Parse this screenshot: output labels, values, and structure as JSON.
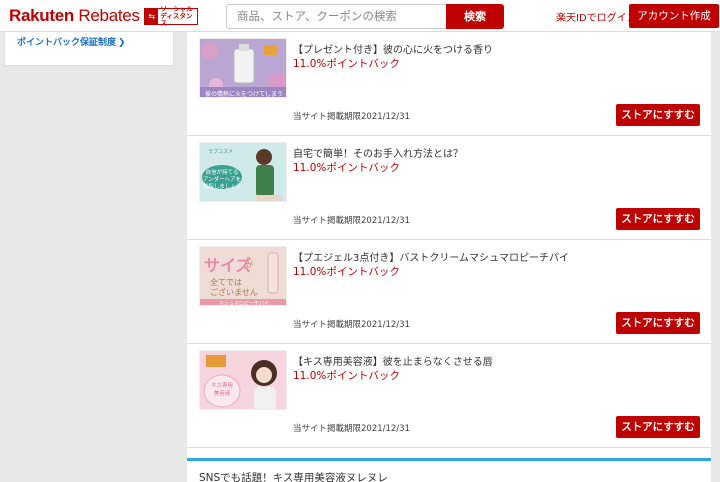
{
  "header": {
    "logo_primary": "Rakuten",
    "logo_secondary": "Rebates",
    "social_badge_line1": "ソーシャル",
    "social_badge_line2": "ディスタンス",
    "search_placeholder": "商品、ストア、クーポンの検索",
    "search_button": "検索",
    "login_link": "楽天IDでログイン",
    "signup_button": "アカウント作成"
  },
  "sidebar": {
    "guarantee_link": "ポイントバック保証制度"
  },
  "cards": [
    {
      "title": "【プレゼント付き】彼の心に火をつける香り",
      "points": "11.0%ポイントバック",
      "deadline": "当サイト掲載期限2021/12/31",
      "button": "ストアにすすむ"
    },
    {
      "title": "自宅で簡単！そのお手入れ方法とは？",
      "points": "11.0%ポイントバック",
      "deadline": "当サイト掲載期限2021/12/31",
      "button": "ストアにすすむ"
    },
    {
      "title": "【プエジェル3点付き】バストクリームマシュマロピーチパイ",
      "points": "11.0%ポイントバック",
      "deadline": "当サイト掲載期限2021/12/31",
      "button": "ストアにすすむ"
    },
    {
      "title": "【キス専用美容液】彼を止まらなくさせる唇",
      "points": "11.0%ポイントバック",
      "deadline": "当サイト掲載期限2021/12/31",
      "button": "ストアにすすむ"
    }
  ],
  "sns_heading": "SNSでも話題！キス専用美容液ヌレヌレ",
  "colors": {
    "brand_red": "#bf0000",
    "link_blue": "#1a6fc5",
    "sns_bar": "#2fa4e7"
  }
}
